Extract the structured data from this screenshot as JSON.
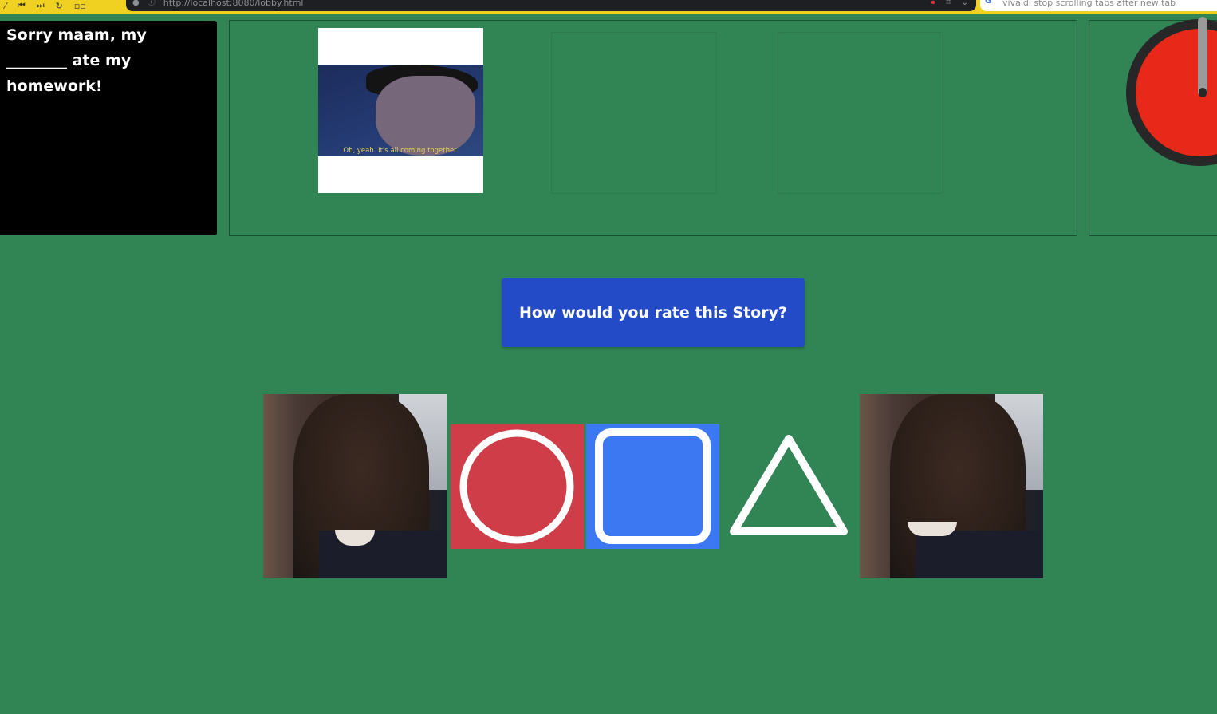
{
  "browser": {
    "url": "http://localhost:8080/lobby.html",
    "tab_title": "vivaldi stop scrolling tabs after new tab"
  },
  "prompt": {
    "line1": "Sorry maam, my",
    "line2": "________ ate my",
    "line3": "homework!"
  },
  "story": {
    "image_caption": "Oh, yeah. It's all coming together."
  },
  "rating": {
    "question": "How would you rate this Story?",
    "options": [
      {
        "shape": "circle",
        "color": "#cf3d48"
      },
      {
        "shape": "square",
        "color": "#3b78f2"
      },
      {
        "shape": "triangle",
        "color": "#318454"
      }
    ]
  },
  "colors": {
    "background": "#318454",
    "banner": "#234bc8",
    "timer": "#e8291a"
  }
}
